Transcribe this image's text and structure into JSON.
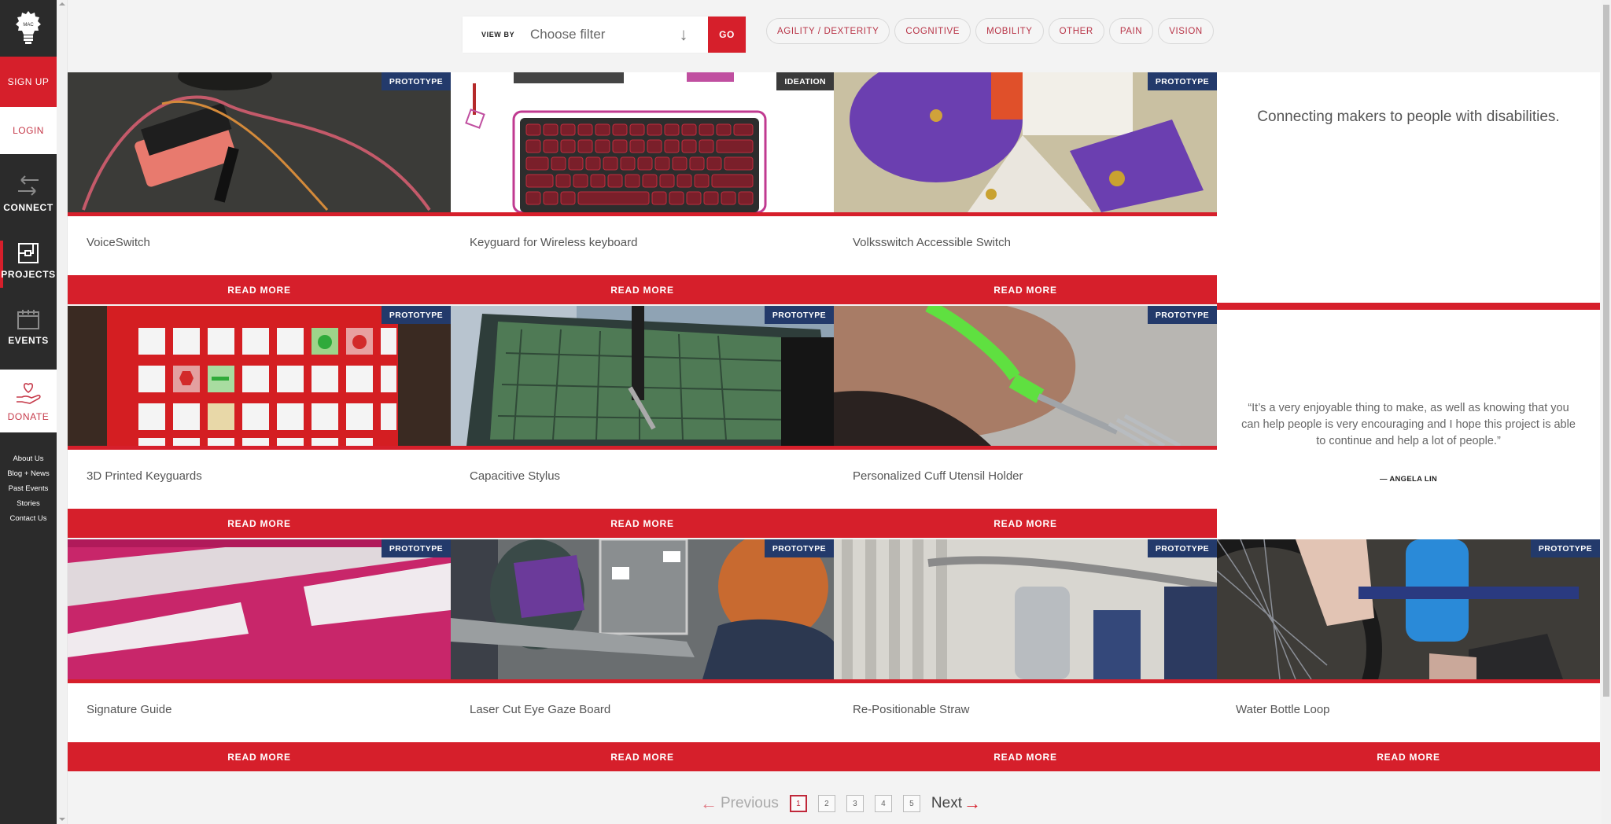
{
  "sidebar": {
    "signup": "SIGN UP",
    "login": "LOGIN",
    "connect": "CONNECT",
    "projects": "PROJECTS",
    "events": "EVENTS",
    "donate": "DONATE",
    "footer_links": [
      "About Us",
      "Blog + News",
      "Past Events",
      "Stories",
      "Contact Us"
    ]
  },
  "filter": {
    "view_by": "VIEW BY",
    "placeholder": "Choose filter",
    "go": "GO"
  },
  "tags": [
    "AGILITY / DEXTERITY",
    "COGNITIVE",
    "MOBILITY",
    "OTHER",
    "PAIN",
    "VISION"
  ],
  "read_more": "READ MORE",
  "projects": [
    {
      "title": "VoiceSwitch",
      "status": "PROTOTYPE"
    },
    {
      "title": "Keyguard for Wireless keyboard",
      "status": "IDEATION"
    },
    {
      "title": "Volksswitch Accessible Switch",
      "status": "PROTOTYPE"
    },
    {
      "title": "3D Printed Keyguards",
      "status": "PROTOTYPE"
    },
    {
      "title": "Capacitive Stylus",
      "status": "PROTOTYPE"
    },
    {
      "title": "Personalized Cuff Utensil Holder",
      "status": "PROTOTYPE"
    },
    {
      "title": "Signature Guide",
      "status": "PROTOTYPE"
    },
    {
      "title": "Laser Cut Eye Gaze Board",
      "status": "PROTOTYPE"
    },
    {
      "title": "Re-Positionable Straw",
      "status": "PROTOTYPE"
    },
    {
      "title": "Water Bottle Loop",
      "status": "PROTOTYPE"
    }
  ],
  "tagline": "Connecting makers to people with disabilities.",
  "testimonial": {
    "quote": "“It’s a very enjoyable thing to make, as well as knowing that you can help people is very encouraging and I hope this project is able to continue and help a lot of people.”",
    "author": "— ANGELA LIN"
  },
  "pagination": {
    "previous": "Previous",
    "next": "Next",
    "pages": [
      "1",
      "2",
      "3",
      "4",
      "5"
    ],
    "current": "1"
  },
  "colors": {
    "brand_red": "#d61f2b",
    "sidebar_bg": "#2b2b2b",
    "prototype_badge": "#233a6b",
    "ideation_badge": "#3a3a3a"
  }
}
